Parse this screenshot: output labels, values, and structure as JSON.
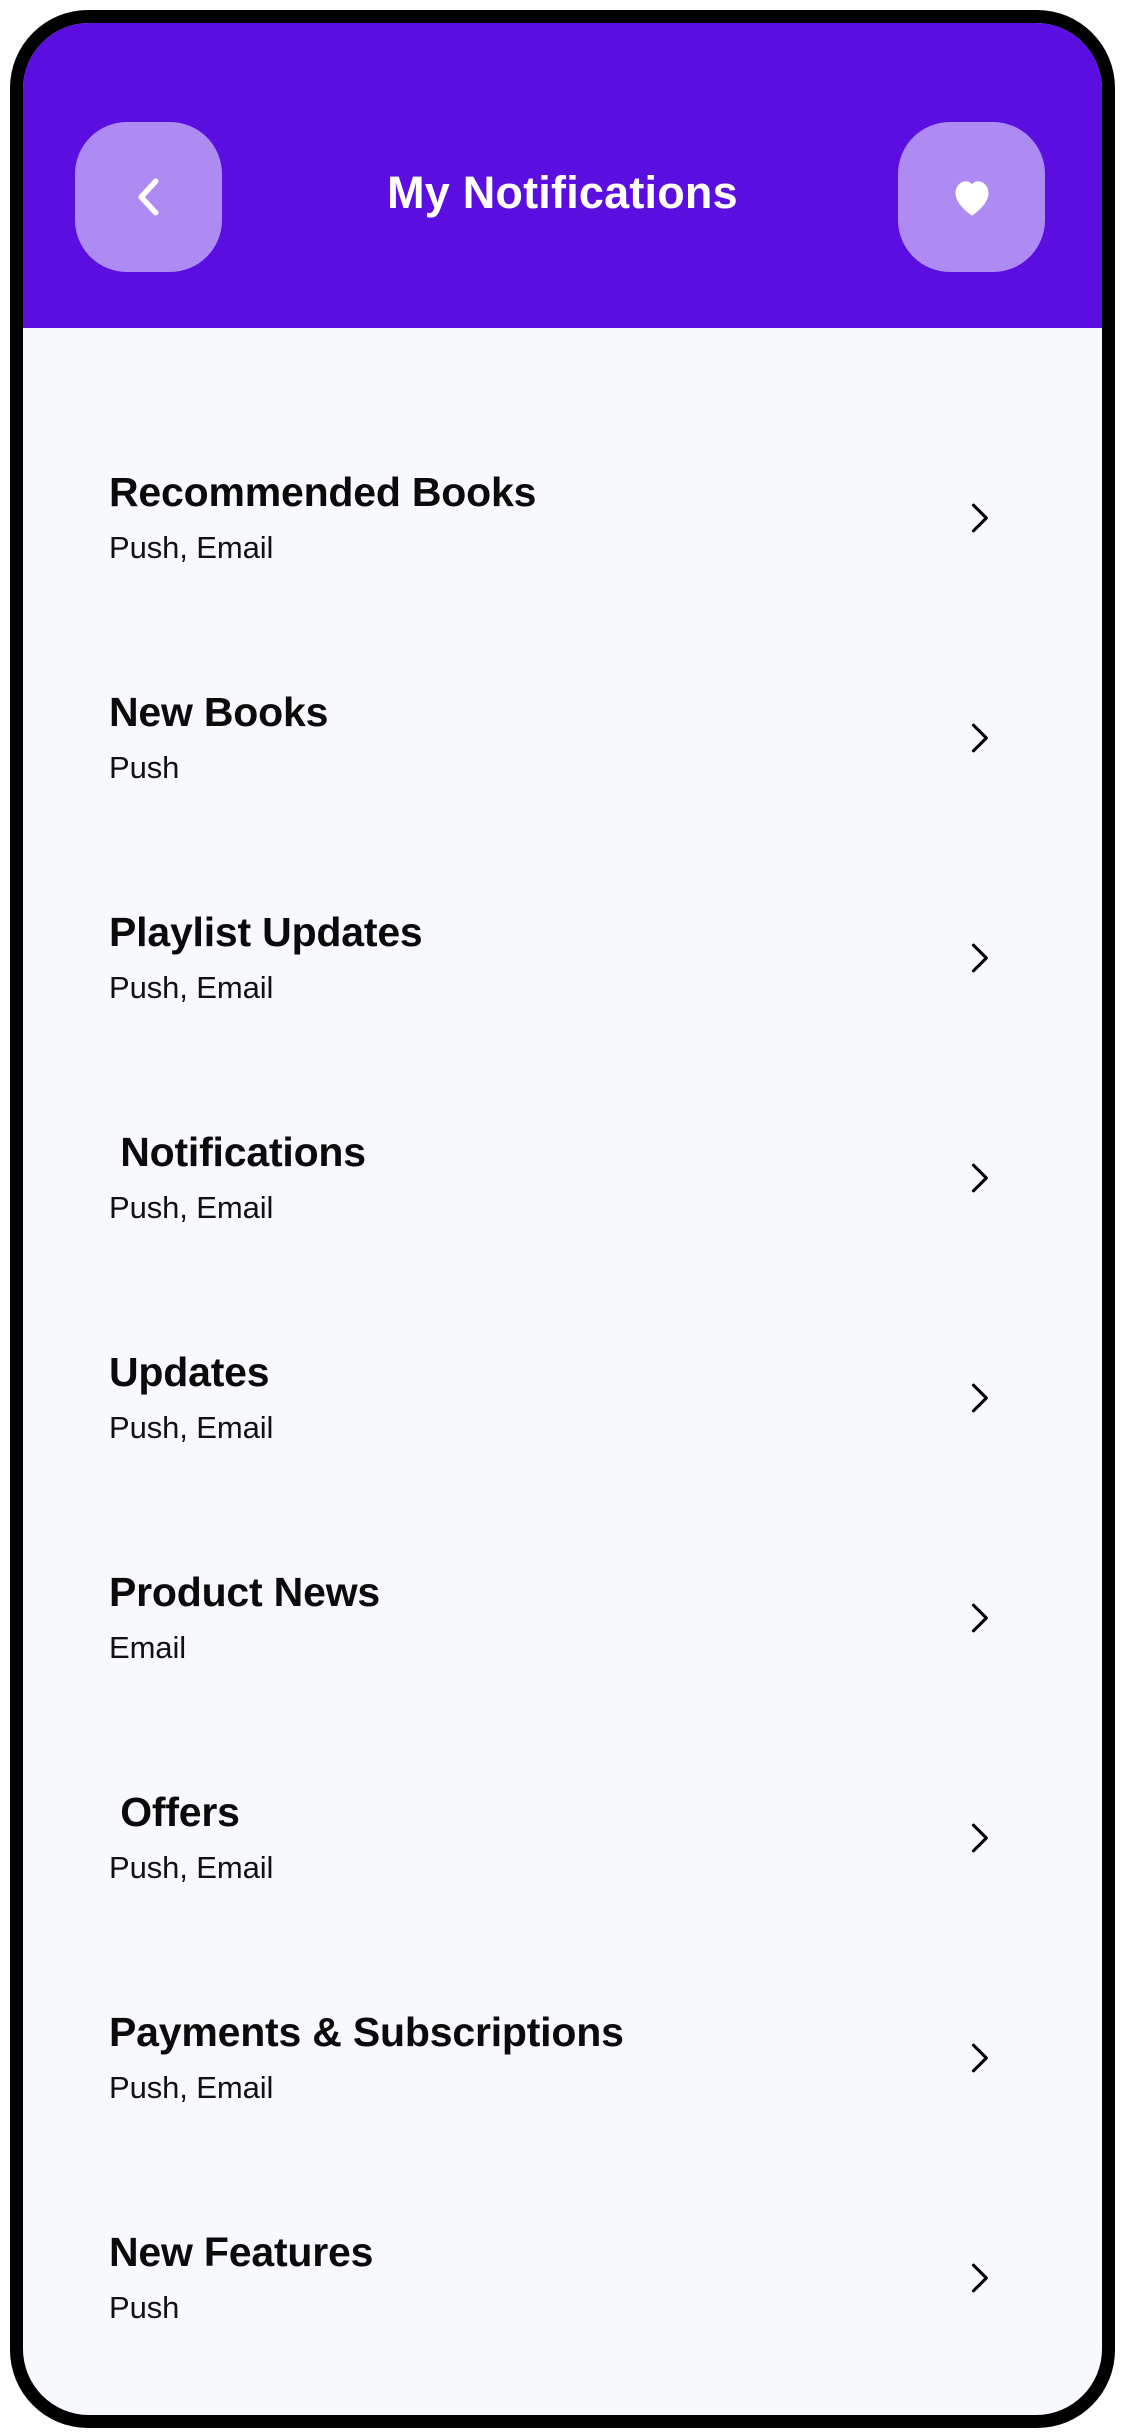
{
  "header": {
    "title": "My Notifications",
    "back_icon": "chevron-left-icon",
    "favorite_icon": "heart-icon",
    "background_color": "#5A0FE0",
    "button_color": "#AE8BF2",
    "title_color": "#FFFFFF"
  },
  "screen": {
    "background_color": "#F8F9FD",
    "frame_color": "#000000"
  },
  "list": {
    "chevron_icon": "chevron-right-icon",
    "items": [
      {
        "title": "Recommended Books",
        "channels": "Push, Email"
      },
      {
        "title": "New Books",
        "channels": "Push"
      },
      {
        "title": "Playlist Updates",
        "channels": "Push, Email"
      },
      {
        "title": " Notifications",
        "channels": "Push, Email"
      },
      {
        "title": "Updates",
        "channels": "Push, Email"
      },
      {
        "title": "Product News",
        "channels": "Email"
      },
      {
        "title": " Offers",
        "channels": "Push, Email"
      },
      {
        "title": "Payments & Subscriptions",
        "channels": "Push, Email"
      },
      {
        "title": "New Features",
        "channels": "Push"
      }
    ]
  }
}
